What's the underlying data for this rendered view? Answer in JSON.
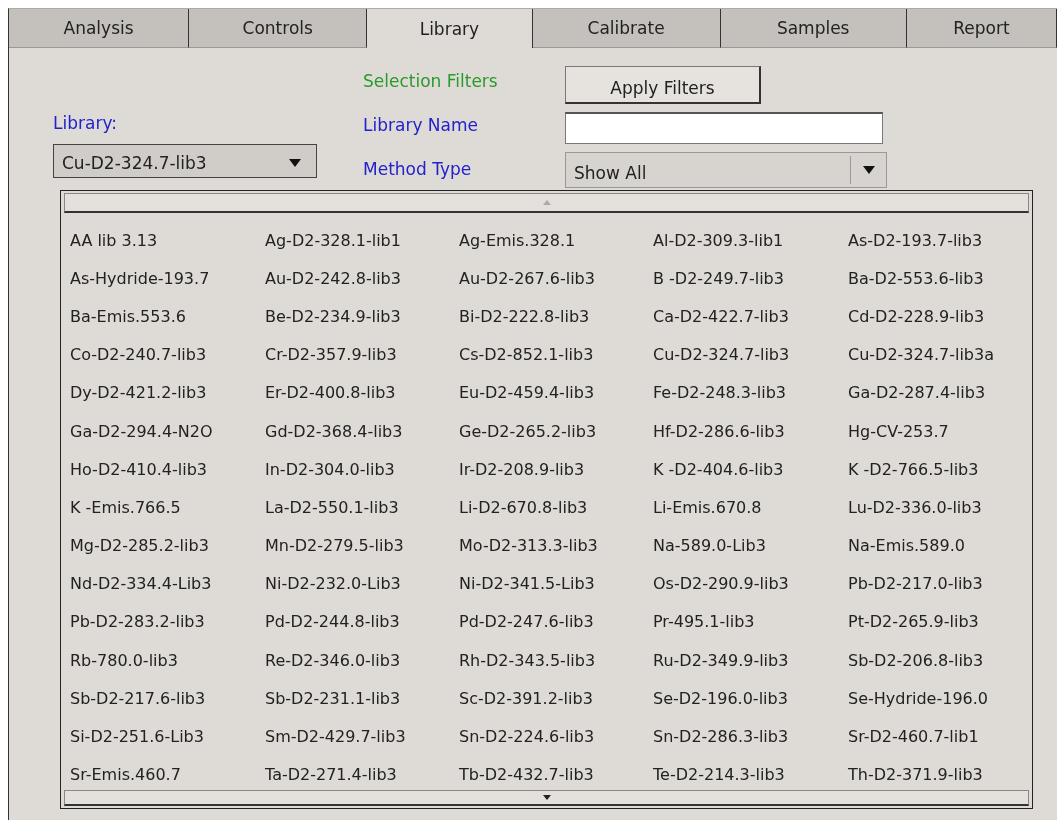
{
  "tabs": [
    {
      "label": "Analysis",
      "selected": false
    },
    {
      "label": "Controls",
      "selected": false
    },
    {
      "label": "Library",
      "selected": true
    },
    {
      "label": "Calibrate",
      "selected": false
    },
    {
      "label": "Samples",
      "selected": false
    },
    {
      "label": "Report",
      "selected": false
    }
  ],
  "library": {
    "label": "Library:",
    "value": "Cu-D2-324.7-lib3",
    "expanded": true
  },
  "filters": {
    "title": "Selection Filters",
    "apply_button": "Apply Filters",
    "name_label": "Library Name",
    "method_label": "Method Type",
    "method_value": "Show All"
  },
  "dropdown": {
    "rows": [
      [
        "AA lib 3.13",
        "Ag-D2-328.1-lib1",
        "Ag-Emis.328.1",
        "Al-D2-309.3-lib1",
        "As-D2-193.7-lib3"
      ],
      [
        "As-Hydride-193.7",
        "Au-D2-242.8-lib3",
        "Au-D2-267.6-lib3",
        "B -D2-249.7-lib3",
        "Ba-D2-553.6-lib3"
      ],
      [
        "Ba-Emis.553.6",
        "Be-D2-234.9-lib3",
        "Bi-D2-222.8-lib3",
        "Ca-D2-422.7-lib3",
        "Cd-D2-228.9-lib3"
      ],
      [
        "Co-D2-240.7-lib3",
        "Cr-D2-357.9-lib3",
        "Cs-D2-852.1-lib3",
        "Cu-D2-324.7-lib3",
        "Cu-D2-324.7-lib3a"
      ],
      [
        "Dy-D2-421.2-lib3",
        "Er-D2-400.8-lib3",
        "Eu-D2-459.4-lib3",
        "Fe-D2-248.3-lib3",
        "Ga-D2-287.4-lib3"
      ],
      [
        "Ga-D2-294.4-N2O",
        "Gd-D2-368.4-lib3",
        "Ge-D2-265.2-lib3",
        "Hf-D2-286.6-lib3",
        "Hg-CV-253.7"
      ],
      [
        "Ho-D2-410.4-lib3",
        "In-D2-304.0-lib3",
        "Ir-D2-208.9-lib3",
        "K -D2-404.6-lib3",
        "K -D2-766.5-lib3"
      ],
      [
        "K -Emis.766.5",
        "La-D2-550.1-lib3",
        "Li-D2-670.8-lib3",
        "Li-Emis.670.8",
        "Lu-D2-336.0-lib3"
      ],
      [
        "Mg-D2-285.2-lib3",
        "Mn-D2-279.5-lib3",
        "Mo-D2-313.3-lib3",
        "Na-589.0-Lib3",
        "Na-Emis.589.0"
      ],
      [
        "Nd-D2-334.4-Lib3",
        "Ni-D2-232.0-Lib3",
        "Ni-D2-341.5-Lib3",
        "Os-D2-290.9-lib3",
        "Pb-D2-217.0-lib3"
      ],
      [
        "Pb-D2-283.2-lib3",
        "Pd-D2-244.8-lib3",
        "Pd-D2-247.6-lib3",
        "Pr-495.1-lib3",
        "Pt-D2-265.9-lib3"
      ],
      [
        "Rb-780.0-lib3",
        "Re-D2-346.0-lib3",
        "Rh-D2-343.5-lib3",
        "Ru-D2-349.9-lib3",
        "Sb-D2-206.8-lib3"
      ],
      [
        "Sb-D2-217.6-lib3",
        "Sb-D2-231.1-lib3",
        "Sc-D2-391.2-lib3",
        "Se-D2-196.0-lib3",
        "Se-Hydride-196.0"
      ],
      [
        "Si-D2-251.6-Lib3",
        "Sm-D2-429.7-lib3",
        "Sn-D2-224.6-lib3",
        "Sn-D2-286.3-lib3",
        "Sr-D2-460.7-lib1"
      ],
      [
        "Sr-Emis.460.7",
        "Ta-D2-271.4-lib3",
        "Tb-D2-432.7-lib3",
        "Te-D2-214.3-lib3",
        "Th-D2-371.9-lib3"
      ]
    ]
  }
}
